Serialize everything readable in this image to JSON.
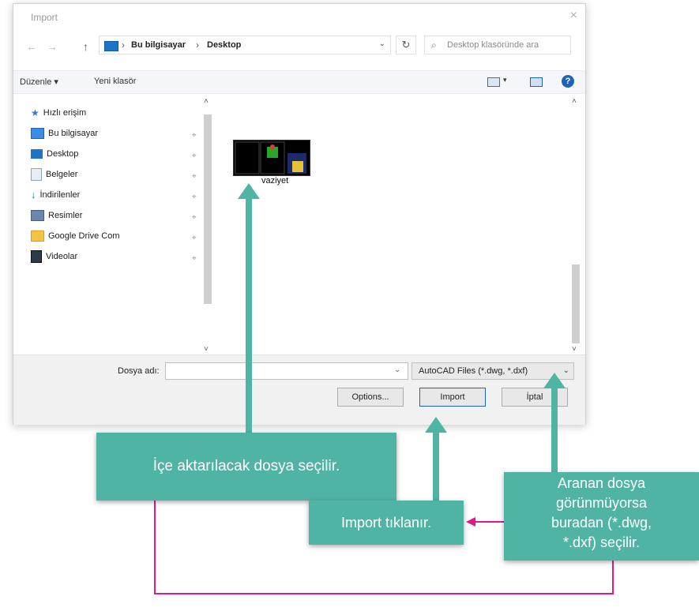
{
  "dialog": {
    "title": "Import",
    "close_glyph": "×",
    "nav": {
      "back": "←",
      "forward": "→",
      "up": "↑"
    },
    "address": {
      "sep": "›",
      "crumbs": [
        "Bu bilgisayar",
        "Desktop"
      ],
      "dropdown": "⌄"
    },
    "refresh_glyph": "↻",
    "search": {
      "placeholder": "Desktop klasöründe ara",
      "icon": "⌕"
    },
    "toolbar": {
      "organize": "Düzenle ▾",
      "new_folder": "Yeni klasör",
      "help": "?"
    },
    "nav_pane": {
      "scroll_up": "˄",
      "scroll_down": "˅",
      "items": [
        {
          "label": "Hızlı erişim",
          "icon": "star-icon"
        },
        {
          "label": "Bu bilgisayar",
          "icon": "computer-icon"
        },
        {
          "label": "Desktop",
          "icon": "desktop-icon"
        },
        {
          "label": "Belgeler",
          "icon": "documents-icon"
        },
        {
          "label": "İndirilenler",
          "icon": "downloads-icon"
        },
        {
          "label": "Resimler",
          "icon": "pictures-icon"
        },
        {
          "label": "Google Drive Com",
          "icon": "folder-icon"
        },
        {
          "label": "Videolar",
          "icon": "videos-icon"
        }
      ],
      "pin_glyph": "⌖"
    },
    "content": {
      "scroll_up": "˄",
      "scroll_down": "˅",
      "files": [
        {
          "name": "vaziyet"
        }
      ]
    },
    "bottom": {
      "file_name_label": "Dosya adı:",
      "file_name_value": "",
      "dropdown_glyph": "⌄",
      "file_type": "AutoCAD Files (*.dwg, *.dxf)",
      "buttons": {
        "options": "Options...",
        "import": "Import",
        "cancel": "İptal"
      }
    }
  },
  "callouts": {
    "select_file": "İçe aktarılacak dosya seçilir.",
    "click_import": "Import tıklanır.",
    "file_type_hint": [
      "Aranan dosya",
      "görünmüyorsa",
      "buradan (*.dwg,",
      "*.dxf) seçilir."
    ]
  },
  "colors": {
    "callout": "#50b4a5",
    "arrow_teal": "#50b4a5",
    "arrow_magenta": "#e0198a"
  }
}
